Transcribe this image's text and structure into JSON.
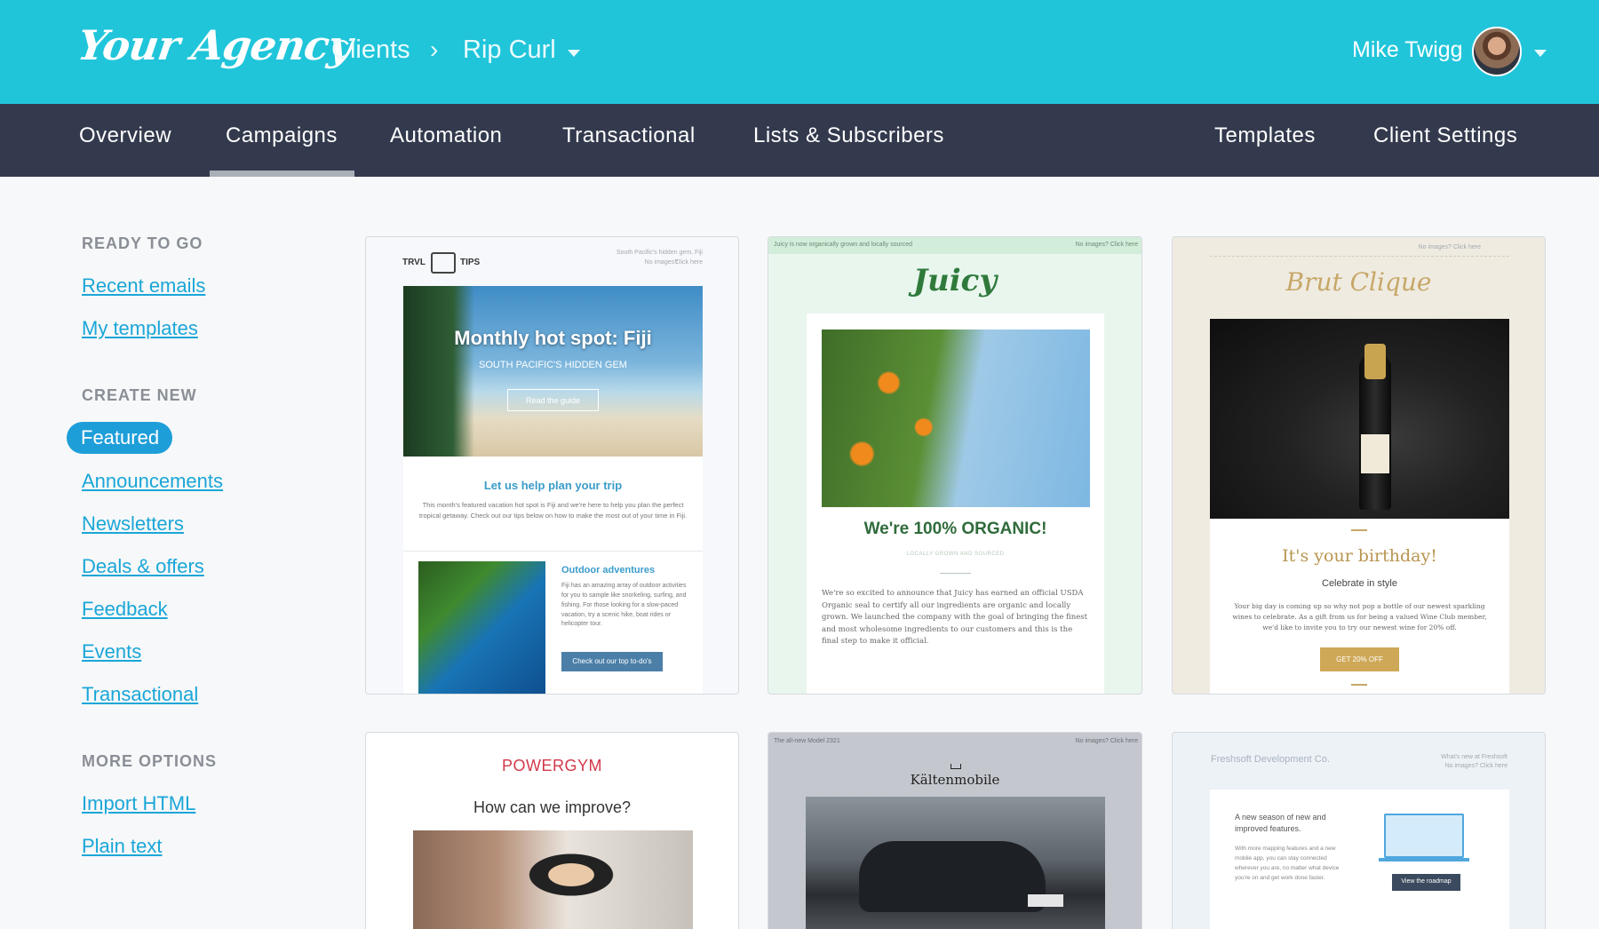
{
  "header": {
    "logo": "Your Agency",
    "breadcrumb": [
      "Clients",
      "Rip Curl"
    ],
    "breadcrumb_sep": "›",
    "user": "Mike Twigg"
  },
  "nav": {
    "left": [
      "Overview",
      "Campaigns",
      "Automation",
      "Transactional",
      "Lists & Subscribers"
    ],
    "right": [
      "Templates",
      "Client Settings"
    ],
    "active": "Campaigns"
  },
  "sidebar": {
    "ready_heading": "READY TO GO",
    "ready_links": [
      "Recent emails",
      "My templates"
    ],
    "create_heading": "CREATE NEW",
    "create_active": "Featured",
    "create_links": [
      "Announcements",
      "Newsletters",
      "Deals & offers",
      "Feedback",
      "Events",
      "Transactional"
    ],
    "more_heading": "MORE OPTIONS",
    "more_links": [
      "Import HTML",
      "Plain text"
    ]
  },
  "templates": {
    "travel": {
      "logo_left": "TRVL",
      "logo_right": "TIPS",
      "preheader": "South Pacific's hidden gem, Fiji",
      "no_images": "No images?",
      "click_here": "Click here",
      "hero_title": "Monthly hot spot: Fiji",
      "hero_sub": "SOUTH PACIFIC'S HIDDEN GEM",
      "hero_btn": "Read the guide",
      "section_title": "Let us help plan your trip",
      "section_body": "This month's featured vacation hot spot is Fiji and we're here to help you plan the perfect tropical getaway. Check out our tips below on how to make the most out of your time in Fiji.",
      "sub_title": "Outdoor adventures",
      "sub_body": "Fiji has an amazing array of outdoor activities for you to sample like snorkeling, surfing, and fishing. For those looking for a slow-paced vacation, try a scenic hike, boat rides or helicopter tour.",
      "sub_btn": "Check out our top to-do's"
    },
    "juicy": {
      "preheader": "Juicy is now organically grown and locally sourced",
      "no_images": "No images? Click here",
      "brand": "Juicy",
      "headline": "We're 100% ORGANIC!",
      "tagline": "LOCALLY GROWN AND SOURCED",
      "body": "We're so excited to announce that Juicy has earned an official USDA Organic seal to certify all our ingredients are organic and locally grown. We launched the company with the goal of bringing the finest and most wholesome ingredients to our customers and this is the final step to make it official."
    },
    "brut": {
      "no_images": "No images? Click here",
      "brand": "Brut Clique",
      "headline": "It's your birthday!",
      "sub": "Celebrate in style",
      "body": "Your big day is coming up so why not pop a bottle of our newest sparkling wines to celebrate. As a gift from us for being a valued Wine Club member, we'd like to invite you to try our newest wine for 20% off.",
      "btn": "GET 20% OFF"
    },
    "powergym": {
      "brand": "POWERGYM",
      "question": "How can we improve?"
    },
    "kalten": {
      "preheader": "The all-new Model 2321",
      "no_images": "No images? Click here",
      "brand": "Kältenmobile"
    },
    "freshsoft": {
      "brand": "Freshsoft Development Co.",
      "preheader": "What's new at Freshsoft",
      "no_images": "No images? Click here",
      "title": "A new season of new and improved features.",
      "body": "With more mapping features and a new mobile app, you can stay connected wherever you are, no matter what device you're on and get work done faster.",
      "btn": "View the roadmap"
    }
  },
  "colors": {
    "topbar": "#20c5da",
    "navbar": "#333a4d",
    "link": "#1aa6d8",
    "pill": "#1e9ed9"
  }
}
